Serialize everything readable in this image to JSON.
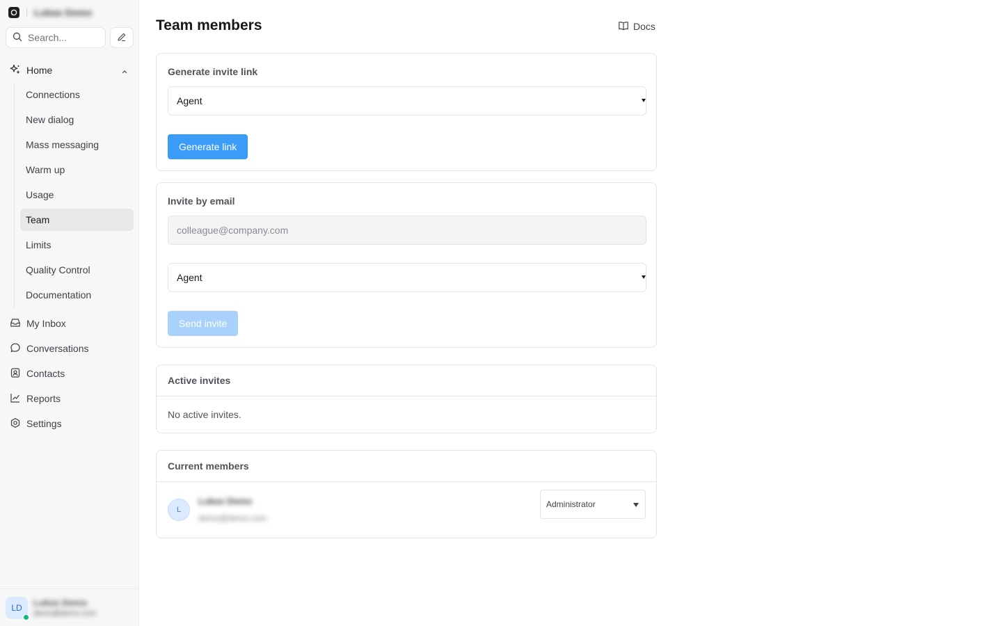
{
  "sidebar": {
    "brand_name": "Lukas Demo",
    "search_placeholder": "Search...",
    "home_label": "Home",
    "sub_items": [
      {
        "label": "Connections"
      },
      {
        "label": "New dialog"
      },
      {
        "label": "Mass messaging"
      },
      {
        "label": "Warm up"
      },
      {
        "label": "Usage"
      },
      {
        "label": "Team"
      },
      {
        "label": "Limits"
      },
      {
        "label": "Quality Control"
      },
      {
        "label": "Documentation"
      }
    ],
    "main_items": [
      {
        "label": "My Inbox",
        "icon": "inbox-icon"
      },
      {
        "label": "Conversations",
        "icon": "chat-bubble-icon"
      },
      {
        "label": "Contacts",
        "icon": "contact-card-icon"
      },
      {
        "label": "Reports",
        "icon": "chart-line-icon"
      },
      {
        "label": "Settings",
        "icon": "gear-icon"
      }
    ],
    "user": {
      "initials": "LD",
      "name": "Lukas Demo",
      "email": "demo@demo.com"
    }
  },
  "header": {
    "title": "Team members",
    "docs_label": "Docs"
  },
  "invite_link": {
    "title": "Generate invite link",
    "role_value": "Agent",
    "button_label": "Generate link"
  },
  "invite_email": {
    "title": "Invite by email",
    "email_placeholder": "colleague@company.com",
    "role_value": "Agent",
    "button_label": "Send invite"
  },
  "active_invites": {
    "title": "Active invites",
    "empty_text": "No active invites."
  },
  "current_members": {
    "title": "Current members",
    "members": [
      {
        "initial": "L",
        "name": "Lukas Demo",
        "email": "demo@demo.com",
        "role": "Administrator"
      }
    ]
  },
  "colors": {
    "primary": "#3b9cf8",
    "primary_disabled": "#a8d2fb",
    "online": "#10b981"
  }
}
